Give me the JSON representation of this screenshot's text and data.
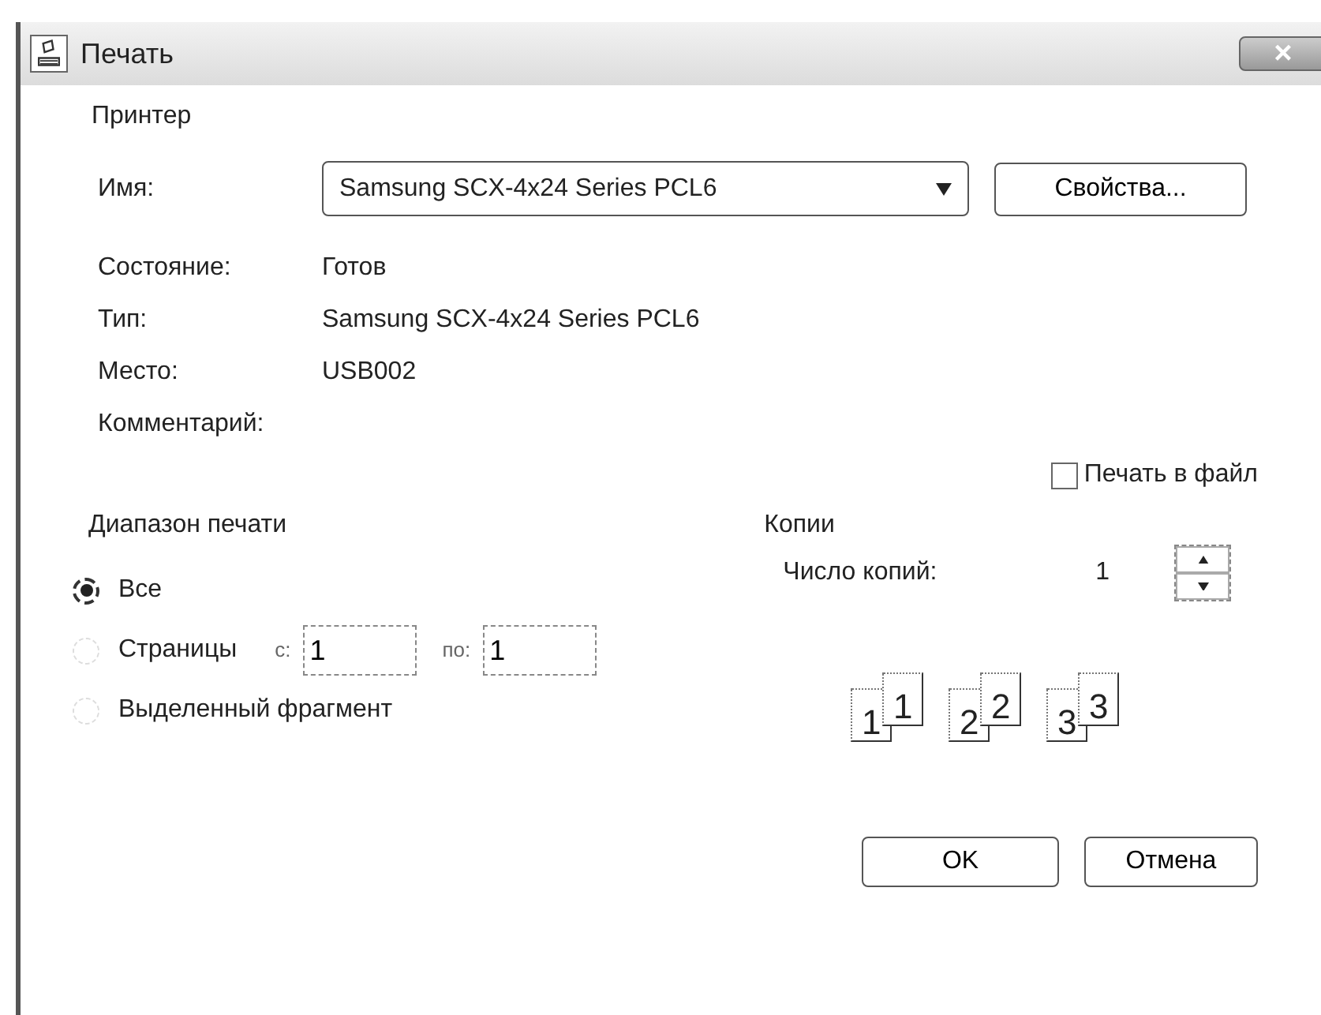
{
  "window": {
    "title": "Печать",
    "close": "×"
  },
  "printer": {
    "heading": "Принтер",
    "name_label": "Имя:",
    "name_value": "Samsung SCX-4x24 Series PCL6",
    "properties_button": "Свойства...",
    "info": [
      {
        "label": "Состояние:",
        "value": "Готов"
      },
      {
        "label": "Тип:",
        "value": "Samsung SCX-4x24 Series PCL6"
      },
      {
        "label": "Место:",
        "value": "USB002"
      },
      {
        "label": "Комментарий:"
      }
    ],
    "print_to_file": {
      "label": "Печать в файл",
      "checked": false
    }
  },
  "print_range": {
    "heading": "Диапазон печати",
    "options": [
      {
        "kind": "plain",
        "label": "Все",
        "selected": true
      },
      {
        "kind": "pages",
        "label": "Страницы",
        "selected": false,
        "from_label": "с:",
        "from_value": "1",
        "to_label": "по:",
        "to_value": "1"
      },
      {
        "kind": "plain",
        "label": "Выделенный фрагмент",
        "selected": false
      }
    ]
  },
  "copies": {
    "heading": "Копии",
    "count_label": "Число копий:",
    "count_value": "1",
    "collate_sets": [
      {
        "front": "1",
        "back": "1"
      },
      {
        "front": "2",
        "back": "2"
      },
      {
        "front": "3",
        "back": "3"
      }
    ]
  },
  "buttons": [
    "OK",
    "Отмена"
  ]
}
